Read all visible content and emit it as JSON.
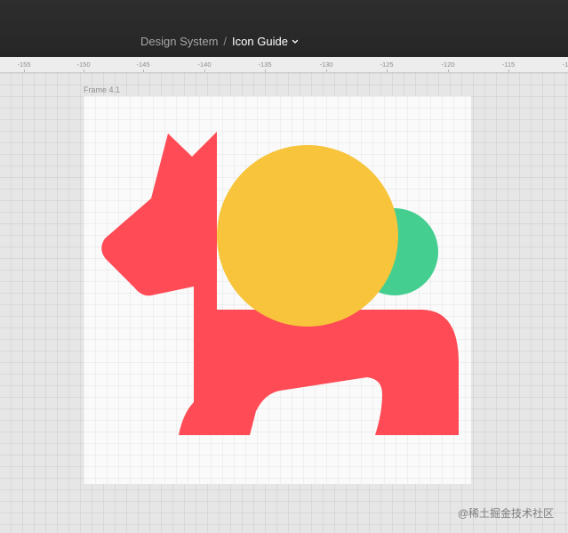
{
  "header": {
    "breadcrumb_parent": "Design System",
    "breadcrumb_separator": "/",
    "breadcrumb_current": "Icon Guide"
  },
  "ruler": {
    "ticks": [
      "-155",
      "-150",
      "-145",
      "-140",
      "-135",
      "-130",
      "-125",
      "-120",
      "-115",
      "-1"
    ]
  },
  "canvas": {
    "frame_label": "Frame 4.1",
    "frame_background": "#fafafa",
    "colors": {
      "horse": "#ff4b55",
      "yellow_circle": "#f7c43c",
      "green_circle": "#44cf91"
    }
  },
  "watermark": "@稀土掘金技术社区"
}
